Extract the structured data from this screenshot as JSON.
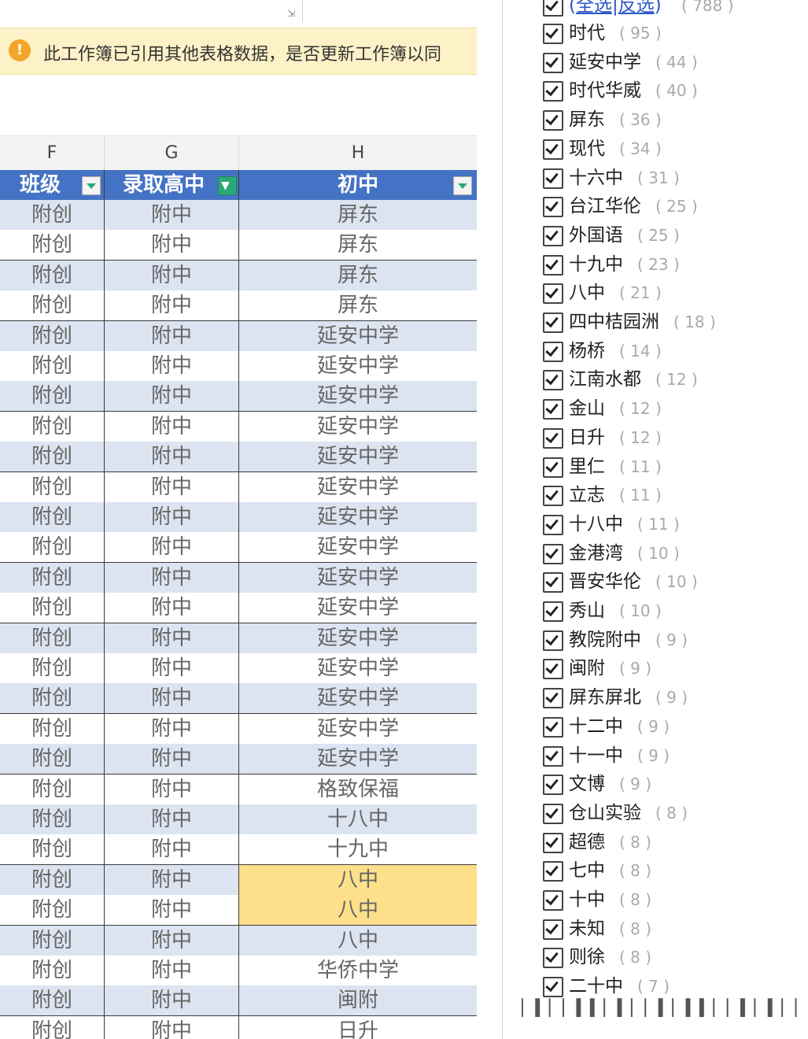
{
  "notice": {
    "icon": "warning-icon",
    "text": "此工作簿已引用其他表格数据，是否更新工作簿以同"
  },
  "columns": [
    "F",
    "G",
    "H"
  ],
  "table": {
    "headers": [
      "班级",
      "录取高中",
      "初中"
    ],
    "rows": [
      [
        "附创",
        "附中",
        "屏东"
      ],
      [
        "附创",
        "附中",
        "屏东"
      ],
      [
        "附创",
        "附中",
        "屏东"
      ],
      [
        "附创",
        "附中",
        "屏东"
      ],
      [
        "附创",
        "附中",
        "延安中学"
      ],
      [
        "附创",
        "附中",
        "延安中学"
      ],
      [
        "附创",
        "附中",
        "延安中学"
      ],
      [
        "附创",
        "附中",
        "延安中学"
      ],
      [
        "附创",
        "附中",
        "延安中学"
      ],
      [
        "附创",
        "附中",
        "延安中学"
      ],
      [
        "附创",
        "附中",
        "延安中学"
      ],
      [
        "附创",
        "附中",
        "延安中学"
      ],
      [
        "附创",
        "附中",
        "延安中学"
      ],
      [
        "附创",
        "附中",
        "延安中学"
      ],
      [
        "附创",
        "附中",
        "延安中学"
      ],
      [
        "附创",
        "附中",
        "延安中学"
      ],
      [
        "附创",
        "附中",
        "延安中学"
      ],
      [
        "附创",
        "附中",
        "延安中学"
      ],
      [
        "附创",
        "附中",
        "延安中学"
      ],
      [
        "附创",
        "附中",
        "格致保福"
      ],
      [
        "附创",
        "附中",
        "十八中"
      ],
      [
        "附创",
        "附中",
        "十九中"
      ],
      [
        "附创",
        "附中",
        "八中"
      ],
      [
        "附创",
        "附中",
        "八中"
      ],
      [
        "附创",
        "附中",
        "八中"
      ],
      [
        "附创",
        "附中",
        "华侨中学"
      ],
      [
        "附创",
        "附中",
        "闽附"
      ],
      [
        "附创",
        "附中",
        "日升"
      ]
    ],
    "highlighted_rows": [
      22,
      23
    ],
    "highlight_color": "#ffe08a",
    "header_color": "#4472c4",
    "band_color": "#dce3f1"
  },
  "filter": {
    "select_all": "全选",
    "separator": "|",
    "invert": "反选",
    "total": "788",
    "items": [
      {
        "label": "时代",
        "count": "95",
        "checked": true
      },
      {
        "label": "延安中学",
        "count": "44",
        "checked": true
      },
      {
        "label": "时代华威",
        "count": "40",
        "checked": true
      },
      {
        "label": "屏东",
        "count": "36",
        "checked": true
      },
      {
        "label": "现代",
        "count": "34",
        "checked": true
      },
      {
        "label": "十六中",
        "count": "31",
        "checked": true
      },
      {
        "label": "台江华伦",
        "count": "25",
        "checked": true
      },
      {
        "label": "外国语",
        "count": "25",
        "checked": true
      },
      {
        "label": "十九中",
        "count": "23",
        "checked": true
      },
      {
        "label": "八中",
        "count": "21",
        "checked": true
      },
      {
        "label": "四中桔园洲",
        "count": "18",
        "checked": true
      },
      {
        "label": "杨桥",
        "count": "14",
        "checked": true
      },
      {
        "label": "江南水都",
        "count": "12",
        "checked": true
      },
      {
        "label": "金山",
        "count": "12",
        "checked": true
      },
      {
        "label": "日升",
        "count": "12",
        "checked": true
      },
      {
        "label": "里仁",
        "count": "11",
        "checked": true
      },
      {
        "label": "立志",
        "count": "11",
        "checked": true
      },
      {
        "label": "十八中",
        "count": "11",
        "checked": true
      },
      {
        "label": "金港湾",
        "count": "10",
        "checked": true
      },
      {
        "label": "晋安华伦",
        "count": "10",
        "checked": true
      },
      {
        "label": "秀山",
        "count": "10",
        "checked": true
      },
      {
        "label": "教院附中",
        "count": "9",
        "checked": true
      },
      {
        "label": "闽附",
        "count": "9",
        "checked": true
      },
      {
        "label": "屏东屏北",
        "count": "9",
        "checked": true
      },
      {
        "label": "十二中",
        "count": "9",
        "checked": true
      },
      {
        "label": "十一中",
        "count": "9",
        "checked": true
      },
      {
        "label": "文博",
        "count": "9",
        "checked": true
      },
      {
        "label": "仓山实验",
        "count": "8",
        "checked": true
      },
      {
        "label": "超德",
        "count": "8",
        "checked": true
      },
      {
        "label": "七中",
        "count": "8",
        "checked": true
      },
      {
        "label": "十中",
        "count": "8",
        "checked": true
      },
      {
        "label": "未知",
        "count": "8",
        "checked": true
      },
      {
        "label": "则徐",
        "count": "8",
        "checked": true
      },
      {
        "label": "二十中",
        "count": "7",
        "checked": true
      }
    ]
  }
}
